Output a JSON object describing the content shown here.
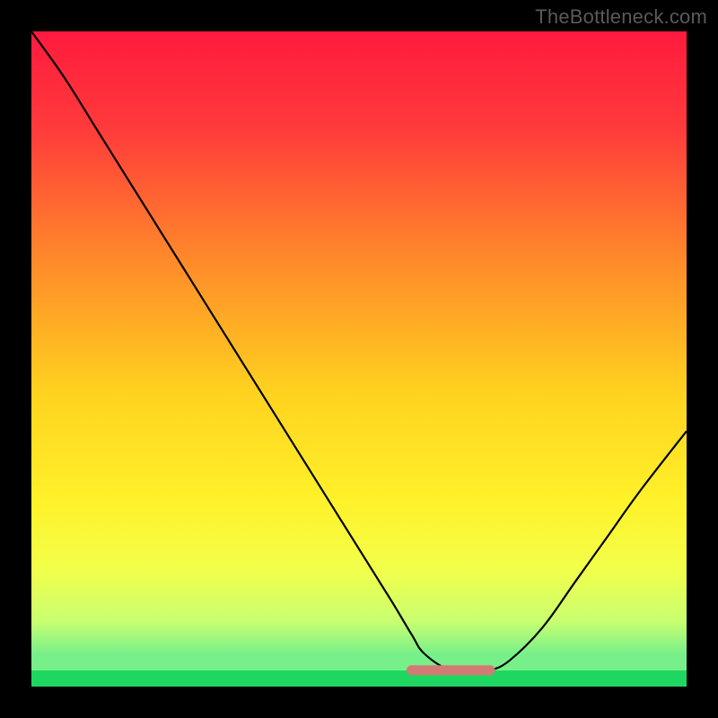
{
  "attribution": "TheBottleneck.com",
  "chart_data": {
    "type": "line",
    "title": "",
    "xlabel": "",
    "ylabel": "",
    "xlim": [
      0,
      100
    ],
    "ylim": [
      0,
      100
    ],
    "grid": false,
    "legend": false,
    "series": [
      {
        "name": "bottleneck-curve",
        "x": [
          0,
          5,
          10,
          15,
          20,
          25,
          30,
          35,
          40,
          45,
          50,
          55,
          58,
          60,
          64,
          68,
          70,
          73,
          78,
          83,
          88,
          93,
          100
        ],
        "y": [
          100,
          93,
          85,
          77,
          69,
          61,
          53,
          45,
          37,
          29,
          21,
          13,
          8,
          5,
          2.5,
          2.5,
          2.5,
          4,
          9,
          16,
          23,
          30,
          39
        ]
      },
      {
        "name": "optimal-range",
        "x": [
          58,
          70
        ],
        "y": [
          2.5,
          2.5
        ]
      }
    ],
    "gradient_stops": [
      {
        "offset": 0.0,
        "color": "#ff1a3e"
      },
      {
        "offset": 0.15,
        "color": "#ff3b3b"
      },
      {
        "offset": 0.35,
        "color": "#ff8a2a"
      },
      {
        "offset": 0.55,
        "color": "#ffd21f"
      },
      {
        "offset": 0.72,
        "color": "#fff22a"
      },
      {
        "offset": 0.82,
        "color": "#f2ff4a"
      },
      {
        "offset": 0.9,
        "color": "#c9ff70"
      },
      {
        "offset": 0.95,
        "color": "#78f08a"
      }
    ],
    "bottom_bar_color": "#1ed760"
  }
}
